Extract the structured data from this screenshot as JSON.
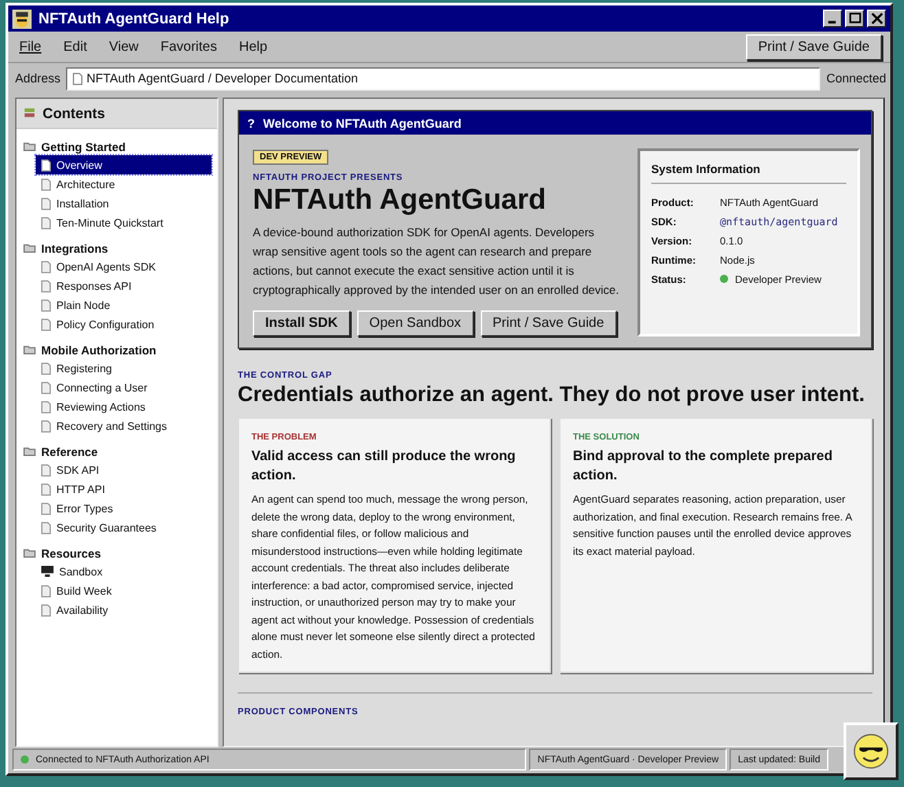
{
  "window": {
    "title": "NFTAuth AgentGuard Help"
  },
  "menu": [
    {
      "label": "File",
      "underlined": true
    },
    {
      "label": "Edit",
      "underlined": false
    },
    {
      "label": "View",
      "underlined": false
    },
    {
      "label": "Favorites",
      "underlined": false
    },
    {
      "label": "Help",
      "underlined": false
    }
  ],
  "toolbar_button": "Print / Save Guide",
  "address": {
    "label": "Address",
    "value": "NFTAuth AgentGuard / Developer Documentation",
    "status": "Connected"
  },
  "sidebar": {
    "title": "Contents",
    "sections": [
      {
        "title": "Getting Started",
        "items": [
          {
            "label": "Overview",
            "selected": true,
            "kind": "page"
          },
          {
            "label": "Architecture",
            "selected": false,
            "kind": "page"
          },
          {
            "label": "Installation",
            "selected": false,
            "kind": "page"
          },
          {
            "label": "Ten-Minute Quickstart",
            "selected": false,
            "kind": "page"
          }
        ]
      },
      {
        "title": "Integrations",
        "items": [
          {
            "label": "OpenAI Agents SDK",
            "selected": false,
            "kind": "page"
          },
          {
            "label": "Responses API",
            "selected": false,
            "kind": "page"
          },
          {
            "label": "Plain Node",
            "selected": false,
            "kind": "page"
          },
          {
            "label": "Policy Configuration",
            "selected": false,
            "kind": "page"
          }
        ]
      },
      {
        "title": "Mobile Authorization",
        "items": [
          {
            "label": "Registering",
            "selected": false,
            "kind": "page"
          },
          {
            "label": "Connecting a User",
            "selected": false,
            "kind": "page"
          },
          {
            "label": "Reviewing Actions",
            "selected": false,
            "kind": "page"
          },
          {
            "label": "Recovery and Settings",
            "selected": false,
            "kind": "page"
          }
        ]
      },
      {
        "title": "Reference",
        "items": [
          {
            "label": "SDK API",
            "selected": false,
            "kind": "page"
          },
          {
            "label": "HTTP API",
            "selected": false,
            "kind": "page"
          },
          {
            "label": "Error Types",
            "selected": false,
            "kind": "page"
          },
          {
            "label": "Security Guarantees",
            "selected": false,
            "kind": "page"
          }
        ]
      },
      {
        "title": "Resources",
        "items": [
          {
            "label": "Sandbox",
            "selected": false,
            "kind": "monitor"
          },
          {
            "label": "Build Week",
            "selected": false,
            "kind": "page"
          },
          {
            "label": "Availability",
            "selected": false,
            "kind": "page"
          }
        ]
      }
    ]
  },
  "welcome": {
    "icon": "?",
    "title": "Welcome to NFTAuth AgentGuard",
    "badge": "DEV PREVIEW",
    "eyebrow": "NFTAUTH PROJECT PRESENTS",
    "heading": "NFTAuth AgentGuard",
    "description": "A device-bound authorization SDK for OpenAI agents. Developers wrap sensitive agent tools so the agent can research and prepare actions, but cannot execute the exact sensitive action until it is cryptographically approved by the intended user on an enrolled device.",
    "buttons": [
      {
        "label": "Install SDK",
        "primary": true
      },
      {
        "label": "Open Sandbox",
        "primary": false
      },
      {
        "label": "Print / Save Guide",
        "primary": false
      }
    ],
    "system_info": {
      "title": "System Information",
      "rows": [
        {
          "label": "Product:",
          "value": "NFTAuth AgentGuard",
          "kind": "text"
        },
        {
          "label": "SDK:",
          "value": "@nftauth/agentguard",
          "kind": "code"
        },
        {
          "label": "Version:",
          "value": "0.1.0",
          "kind": "text"
        },
        {
          "label": "Runtime:",
          "value": "Node.js",
          "kind": "text"
        },
        {
          "label": "Status:",
          "value": "Developer Preview",
          "kind": "status",
          "color": "#4caf50"
        }
      ]
    }
  },
  "control_gap": {
    "eyebrow": "THE CONTROL GAP",
    "heading": "Credentials authorize an agent. They do not prove user intent.",
    "cards": [
      {
        "label": "THE PROBLEM",
        "color": "#a83232",
        "title": "Valid access can still produce the wrong action.",
        "body": "An agent can spend too much, message the wrong person, delete the wrong data, deploy to the wrong environment, share confidential files, or follow malicious and misunderstood instructions—even while holding legitimate account credentials. The threat also includes deliberate interference: a bad actor, compromised service, injected instruction, or unauthorized person may try to make your agent act without your knowledge. Possession of credentials alone must never let someone else silently direct a protected action."
      },
      {
        "label": "THE SOLUTION",
        "color": "#3a8a4a",
        "title": "Bind approval to the complete prepared action.",
        "body": "AgentGuard separates reasoning, action preparation, user authorization, and final execution. Research remains free. A sensitive function pauses until the enrolled device approves its exact material payload."
      }
    ]
  },
  "components": {
    "eyebrow": "PRODUCT COMPONENTS"
  },
  "status_bar": {
    "connection": "Connected to NFTAuth Authorization API",
    "color": "#4caf50",
    "product": "NFTAuth AgentGuard · Developer Preview",
    "updated": "Last updated: Build"
  }
}
